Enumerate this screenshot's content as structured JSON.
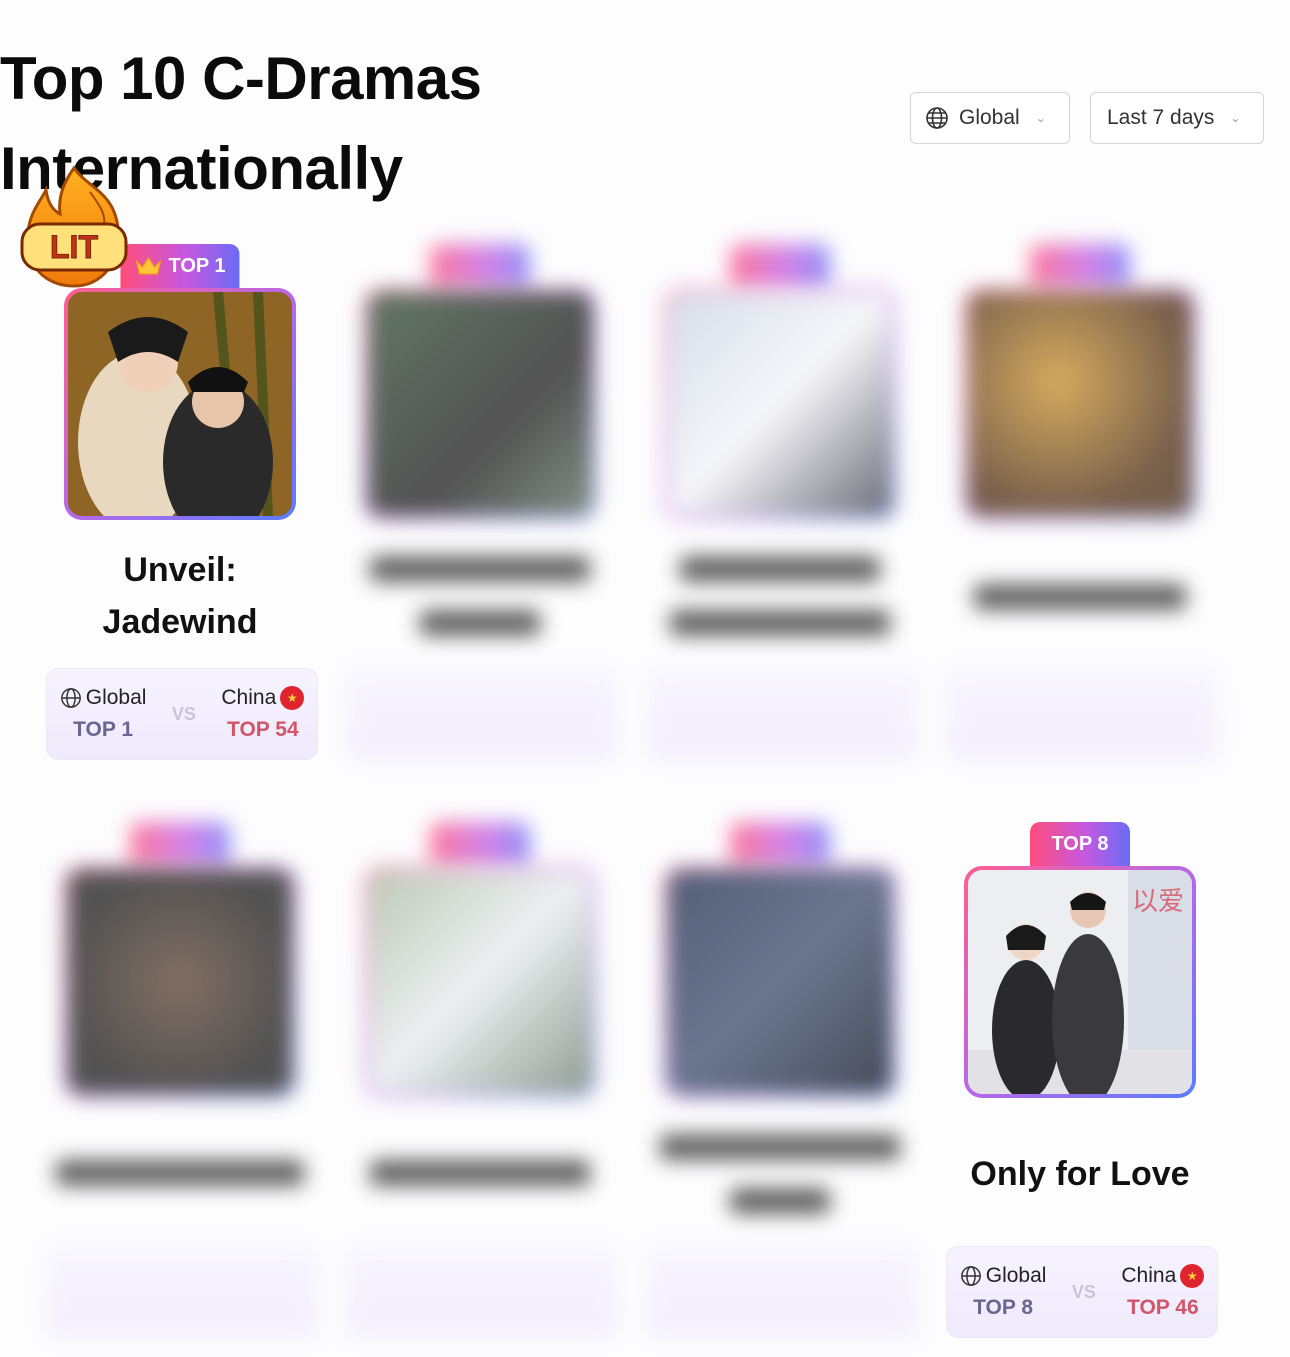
{
  "page": {
    "title": "Top 10 C-Dramas Internationally"
  },
  "filters": {
    "region": "Global",
    "period": "Last 7 days"
  },
  "lit_badge": {
    "text": "LIT",
    "icon": "fire-icon"
  },
  "labels": {
    "global": "Global",
    "china": "China",
    "vs": "VS"
  },
  "dramas": [
    {
      "rank_label": "TOP 1",
      "title": "Unveil: Jadewind",
      "global_rank": "TOP 1",
      "china_rank": "TOP 54",
      "blurred": false
    },
    {
      "rank_label": "",
      "title": "",
      "global_rank": "",
      "china_rank": "",
      "blurred": true
    },
    {
      "rank_label": "",
      "title": "",
      "global_rank": "",
      "china_rank": "",
      "blurred": true
    },
    {
      "rank_label": "",
      "title": "",
      "global_rank": "",
      "china_rank": "",
      "blurred": true
    },
    {
      "rank_label": "",
      "title": "",
      "global_rank": "",
      "china_rank": "",
      "blurred": true
    },
    {
      "rank_label": "",
      "title": "",
      "global_rank": "",
      "china_rank": "",
      "blurred": true
    },
    {
      "rank_label": "",
      "title": "",
      "global_rank": "",
      "china_rank": "",
      "blurred": true
    },
    {
      "rank_label": "TOP 8",
      "title": "Only for Love",
      "global_rank": "TOP 8",
      "china_rank": "TOP 46",
      "blurred": false
    }
  ],
  "colors": {
    "rank_gradient": [
      "#ff4d7a",
      "#c658e0",
      "#6a6cf5"
    ],
    "china_rank": "#d2566a",
    "global_rank": "#6b6690"
  }
}
